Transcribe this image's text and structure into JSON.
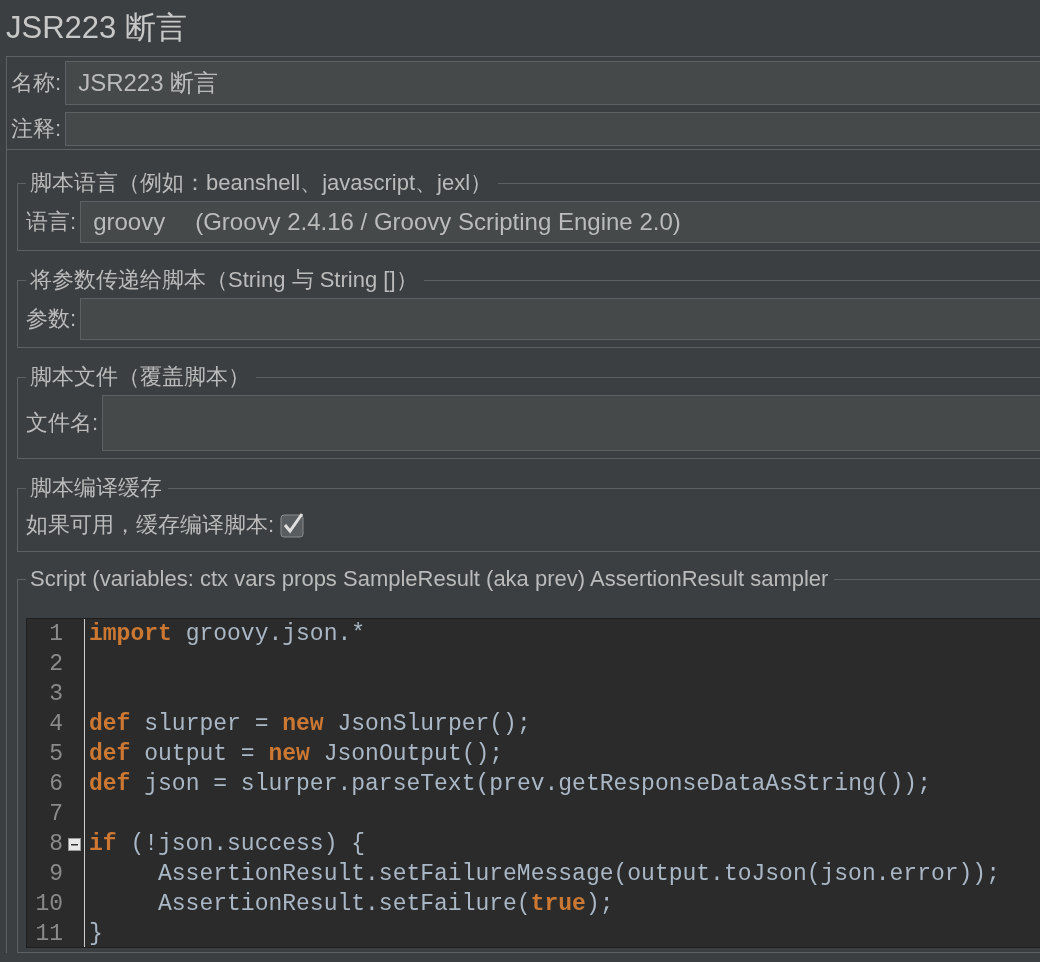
{
  "title": "JSR223 断言",
  "name_field": {
    "label": "名称:",
    "value": "JSR223 断言"
  },
  "comment_field": {
    "label": "注释:"
  },
  "groups": [
    {
      "kind": "language",
      "legend": "脚本语言（例如：beanshell、javascript、jexl）",
      "label": "语言:",
      "value": "groovy",
      "detail": "(Groovy 2.4.16 / Groovy Scripting Engine 2.0)"
    },
    {
      "kind": "field",
      "legend": "将参数传递给脚本（String 与 String []）",
      "label": "参数:"
    },
    {
      "kind": "field",
      "legend": "脚本文件（覆盖脚本）",
      "label": "文件名:"
    },
    {
      "kind": "checkbox",
      "legend": "脚本编译缓存",
      "label": "如果可用，缓存编译脚本:",
      "checked": true
    },
    {
      "kind": "editor",
      "legend": "Script (variables: ctx vars props SampleResult (aka prev) AssertionResult sampler",
      "lines": [
        {
          "number": "1",
          "segments": [
            {
              "text": "import",
              "kind": "keyword"
            },
            {
              "text": " groovy.json.*",
              "kind": "plain"
            }
          ]
        },
        {
          "number": "2"
        },
        {
          "number": "3"
        },
        {
          "number": "4",
          "segments": [
            {
              "text": "def",
              "kind": "keyword"
            },
            {
              "text": " slurper = ",
              "kind": "plain"
            },
            {
              "text": "new",
              "kind": "keyword"
            },
            {
              "text": " JsonSlurper();",
              "kind": "plain"
            }
          ]
        },
        {
          "number": "5",
          "segments": [
            {
              "text": "def",
              "kind": "keyword"
            },
            {
              "text": " output = ",
              "kind": "plain"
            },
            {
              "text": "new",
              "kind": "keyword"
            },
            {
              "text": " JsonOutput();",
              "kind": "plain"
            }
          ]
        },
        {
          "number": "6",
          "segments": [
            {
              "text": "def",
              "kind": "keyword"
            },
            {
              "text": " json = slurper.parseText(prev.getResponseDataAsString());",
              "kind": "plain"
            }
          ]
        },
        {
          "number": "7"
        },
        {
          "number": "8",
          "collapsible": true,
          "segments": [
            {
              "text": "if",
              "kind": "keyword"
            },
            {
              "text": " (!json.success) {",
              "kind": "plain"
            }
          ]
        },
        {
          "number": "9",
          "segments": [
            {
              "text": "     AssertionResult.setFailureMessage(output.toJson(json.error));",
              "kind": "plain"
            }
          ]
        },
        {
          "number": "10",
          "segments": [
            {
              "text": "     AssertionResult.setFailure(",
              "kind": "plain"
            },
            {
              "text": "true",
              "kind": "keyword"
            },
            {
              "text": ");",
              "kind": "plain"
            }
          ]
        },
        {
          "number": "11",
          "segments": [
            {
              "text": "}",
              "kind": "plain"
            }
          ]
        }
      ]
    }
  ]
}
